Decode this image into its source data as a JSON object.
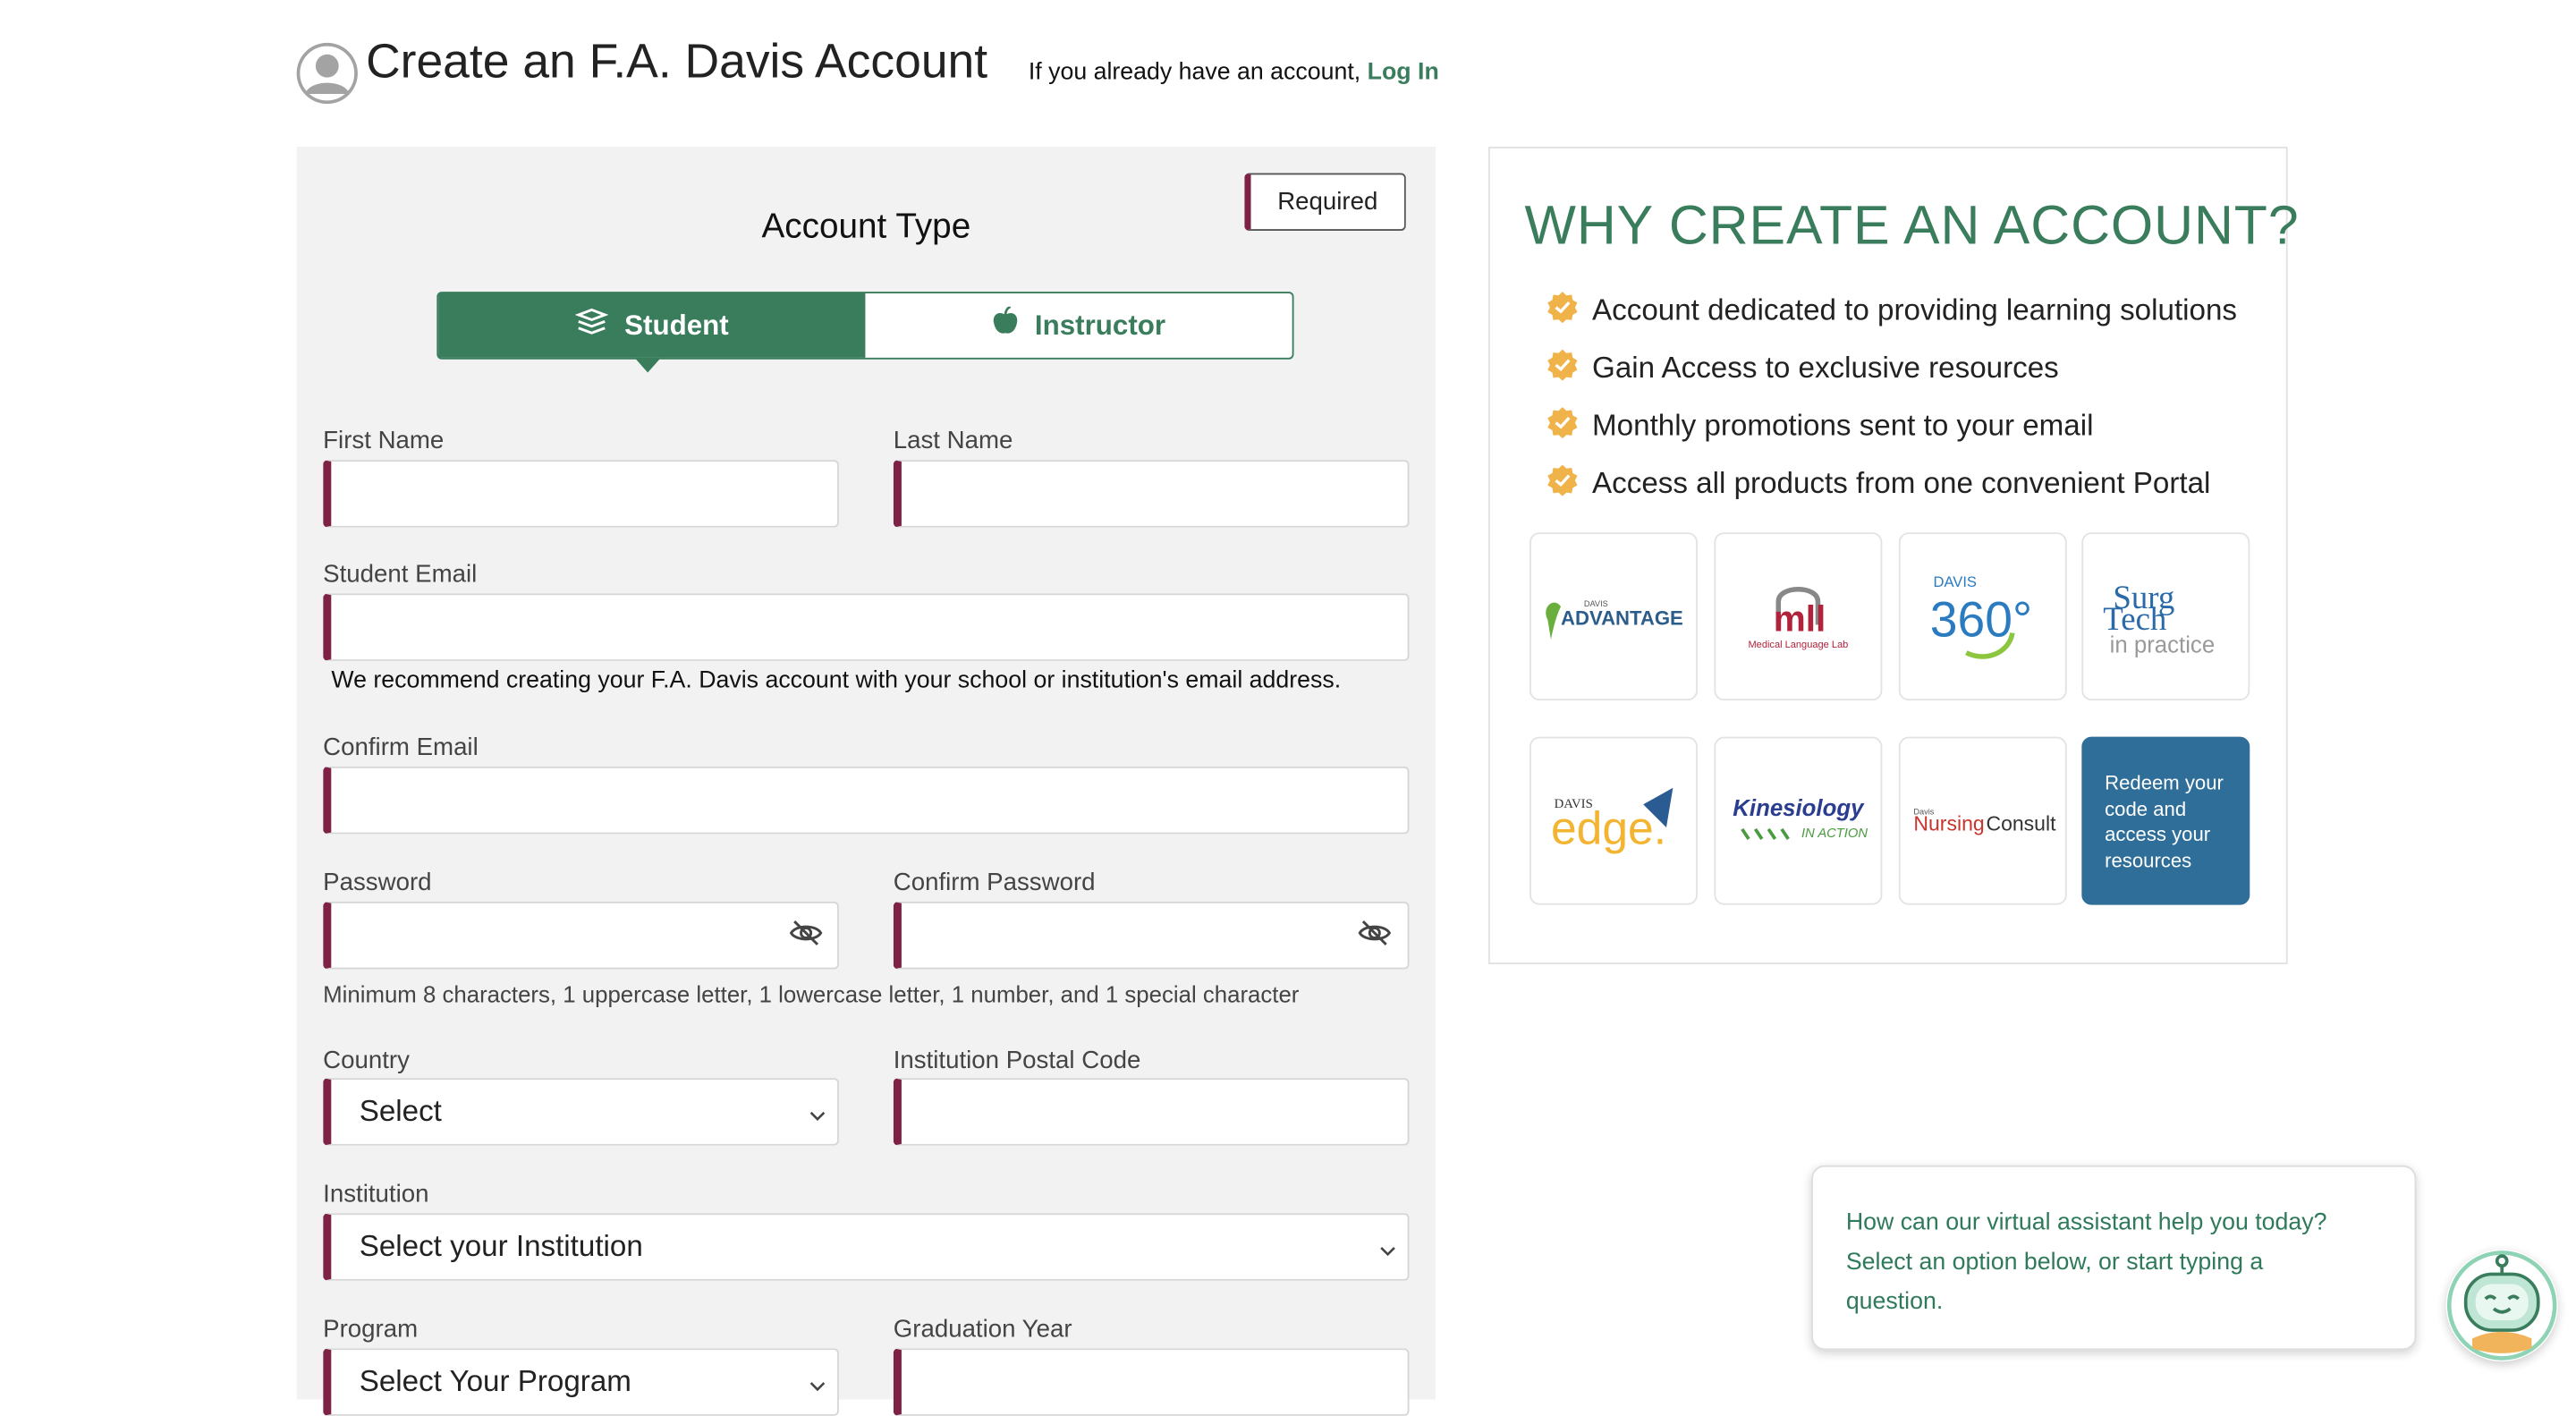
{
  "header": {
    "title": "Create an F.A. Davis Account",
    "login_prompt": "If you already have an account,",
    "login_link": "Log In"
  },
  "form": {
    "required_badge": "Required",
    "account_type_heading": "Account Type",
    "account_types": [
      {
        "label": "Student",
        "selected": true,
        "icon": "books-icon"
      },
      {
        "label": "Instructor",
        "selected": false,
        "icon": "apple-icon"
      }
    ],
    "fields": {
      "first_name": {
        "label": "First Name",
        "value": ""
      },
      "last_name": {
        "label": "Last Name",
        "value": ""
      },
      "student_email": {
        "label": "Student Email",
        "value": "",
        "hint": "We recommend creating your F.A. Davis account with your school or institution's email address."
      },
      "confirm_email": {
        "label": "Confirm Email",
        "value": ""
      },
      "password": {
        "label": "Password",
        "value": ""
      },
      "confirm_password": {
        "label": "Confirm Password",
        "value": ""
      },
      "password_hint": "Minimum 8 characters, 1 uppercase letter, 1 lowercase letter, 1 number, and 1 special character",
      "country": {
        "label": "Country",
        "value": "Select"
      },
      "postal_code": {
        "label": "Institution Postal Code",
        "value": ""
      },
      "institution": {
        "label": "Institution",
        "value": "Select your Institution"
      },
      "program": {
        "label": "Program",
        "value": "Select Your Program"
      },
      "graduation_year": {
        "label": "Graduation Year",
        "value": ""
      }
    }
  },
  "why": {
    "title": "WHY CREATE AN ACCOUNT?",
    "benefits": [
      "Account dedicated to providing learning solutions",
      "Gain Access to exclusive resources",
      "Monthly promotions sent to your email",
      "Access all products from one convenient Portal"
    ],
    "products": [
      {
        "name": "davis-advantage",
        "small": "DAVIS",
        "main": "ADVANTAGE"
      },
      {
        "name": "medical-language-lab",
        "main": "mll",
        "sub": "Medical Language Lab"
      },
      {
        "name": "davis-360",
        "small": "DAVIS",
        "main": "360°"
      },
      {
        "name": "surg-tech-in-practice",
        "main1": "Surg",
        "main2": "Tech",
        "sub": "in practice"
      },
      {
        "name": "davis-edge",
        "small": "DAVIS",
        "main": "edge."
      },
      {
        "name": "kinesiology-in-action",
        "main": "Kinesiology",
        "sub": "IN ACTION"
      },
      {
        "name": "davis-nursing-consult",
        "small": "Davis",
        "main1": "Nursing",
        "main2": "Consult"
      }
    ],
    "redeem": "Redeem your code and access your resources"
  },
  "chat": {
    "message": "How can our virtual assistant help you today? Select an option below, or start typing a question."
  },
  "colors": {
    "brand_green": "#3a7d5c",
    "required_maroon": "#7d2245",
    "badge_orange": "#f0b34a",
    "redeem_blue": "#2f6e99"
  }
}
